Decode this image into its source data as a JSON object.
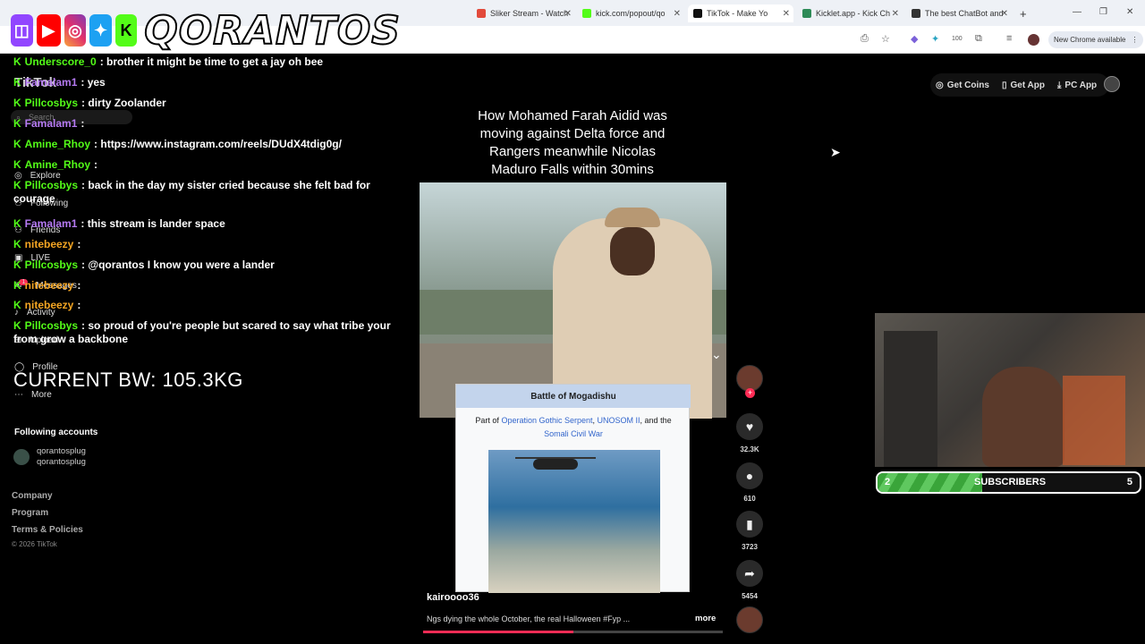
{
  "browser": {
    "tabs": [
      {
        "title": "Sliker Stream - Watch",
        "color": "#e24a3b"
      },
      {
        "title": "kick.com/popout/qo",
        "color": "#53fc18"
      },
      {
        "title": "TikTok - Make Yo",
        "color": "#111111"
      },
      {
        "title": "Kicklet.app - Kick Ch",
        "color": "#2e8b57"
      },
      {
        "title": "The best ChatBot and",
        "color": "#333333"
      }
    ],
    "new_tab": "+",
    "badge_100": "100",
    "new_chrome": "New Chrome available"
  },
  "overlay": {
    "brand": "QORANTOS"
  },
  "tiktok": {
    "logo": "TikTok",
    "search_placeholder": "Search",
    "nav": [
      "Explore",
      "Following",
      "Friends",
      "LIVE",
      "Messages",
      "Activity",
      "Upload",
      "Profile",
      "More"
    ],
    "messages_badge": "1",
    "top": {
      "coins": "Get Coins",
      "app": "Get App",
      "pc": "PC App"
    },
    "following_title": "Following accounts",
    "following": [
      {
        "name": "qorantosplug",
        "handle": "qorantosplug"
      }
    ],
    "footer": [
      "Company",
      "Program",
      "Terms & Policies",
      "© 2026 TikTok"
    ],
    "caption": "How Mohamed Farah Aidid was moving against Delta force and Rangers meanwhile Nicolas Maduro Falls within 30mins",
    "wiki": {
      "title": "Battle of Mogadishu",
      "part_prefix": "Part of",
      "link1": "Operation Gothic Serpent",
      "sep": ",",
      "link2": "UNOSOM II",
      "and": ", and the",
      "link3": "Somali Civil War"
    },
    "author": "kairoooo36",
    "description": "Ngs dying the whole October, the real Halloween #Fyp ...",
    "more": "more",
    "likes": "32.3K",
    "comments": "610",
    "saves": "3723",
    "shares": "5454",
    "progress": 0.5
  },
  "chat": [
    {
      "user": "Underscore_0",
      "color": "#53fc18",
      "text": ": brother it might be time to get a jay oh bee"
    },
    {
      "user": "Famalam1",
      "color": "#b57af2",
      "text": ": yes"
    },
    {
      "user": "Pillcosbys",
      "color": "#53fc18",
      "text": ": dirty Zoolander"
    },
    {
      "user": "Famalam1",
      "color": "#b57af2",
      "text": ":"
    },
    {
      "user": "Amine_Rhoy",
      "color": "#53fc18",
      "text": ": https://www.instagram.com/reels/DUdX4tdig0g/"
    },
    {
      "user": "Amine_Rhoy",
      "color": "#53fc18",
      "text": ":"
    },
    {
      "user": "Pillcosbys",
      "color": "#53fc18",
      "text": ": back in the day my sister cried because she felt bad for courage"
    },
    {
      "user": "Famalam1",
      "color": "#b57af2",
      "text": ": this stream is lander space"
    },
    {
      "user": "nitebeezy",
      "color": "#f5a623",
      "text": ":"
    },
    {
      "user": "Pillcosbys",
      "color": "#53fc18",
      "text": ": @qorantos I know you were a lander"
    },
    {
      "user": "nitebeezy",
      "color": "#f5a623",
      "text": ":"
    },
    {
      "user": "nitebeezy",
      "color": "#f5a623",
      "text": ":"
    },
    {
      "user": "Pillcosbys",
      "color": "#53fc18",
      "text": ": so proud of you're people but scared to say what tribe your from grow a backbone"
    }
  ],
  "bw": "CURRENT BW: 105.3KG",
  "subs": {
    "current": "2",
    "label": "SUBSCRIBERS",
    "goal": "5",
    "progress": 0.4
  }
}
